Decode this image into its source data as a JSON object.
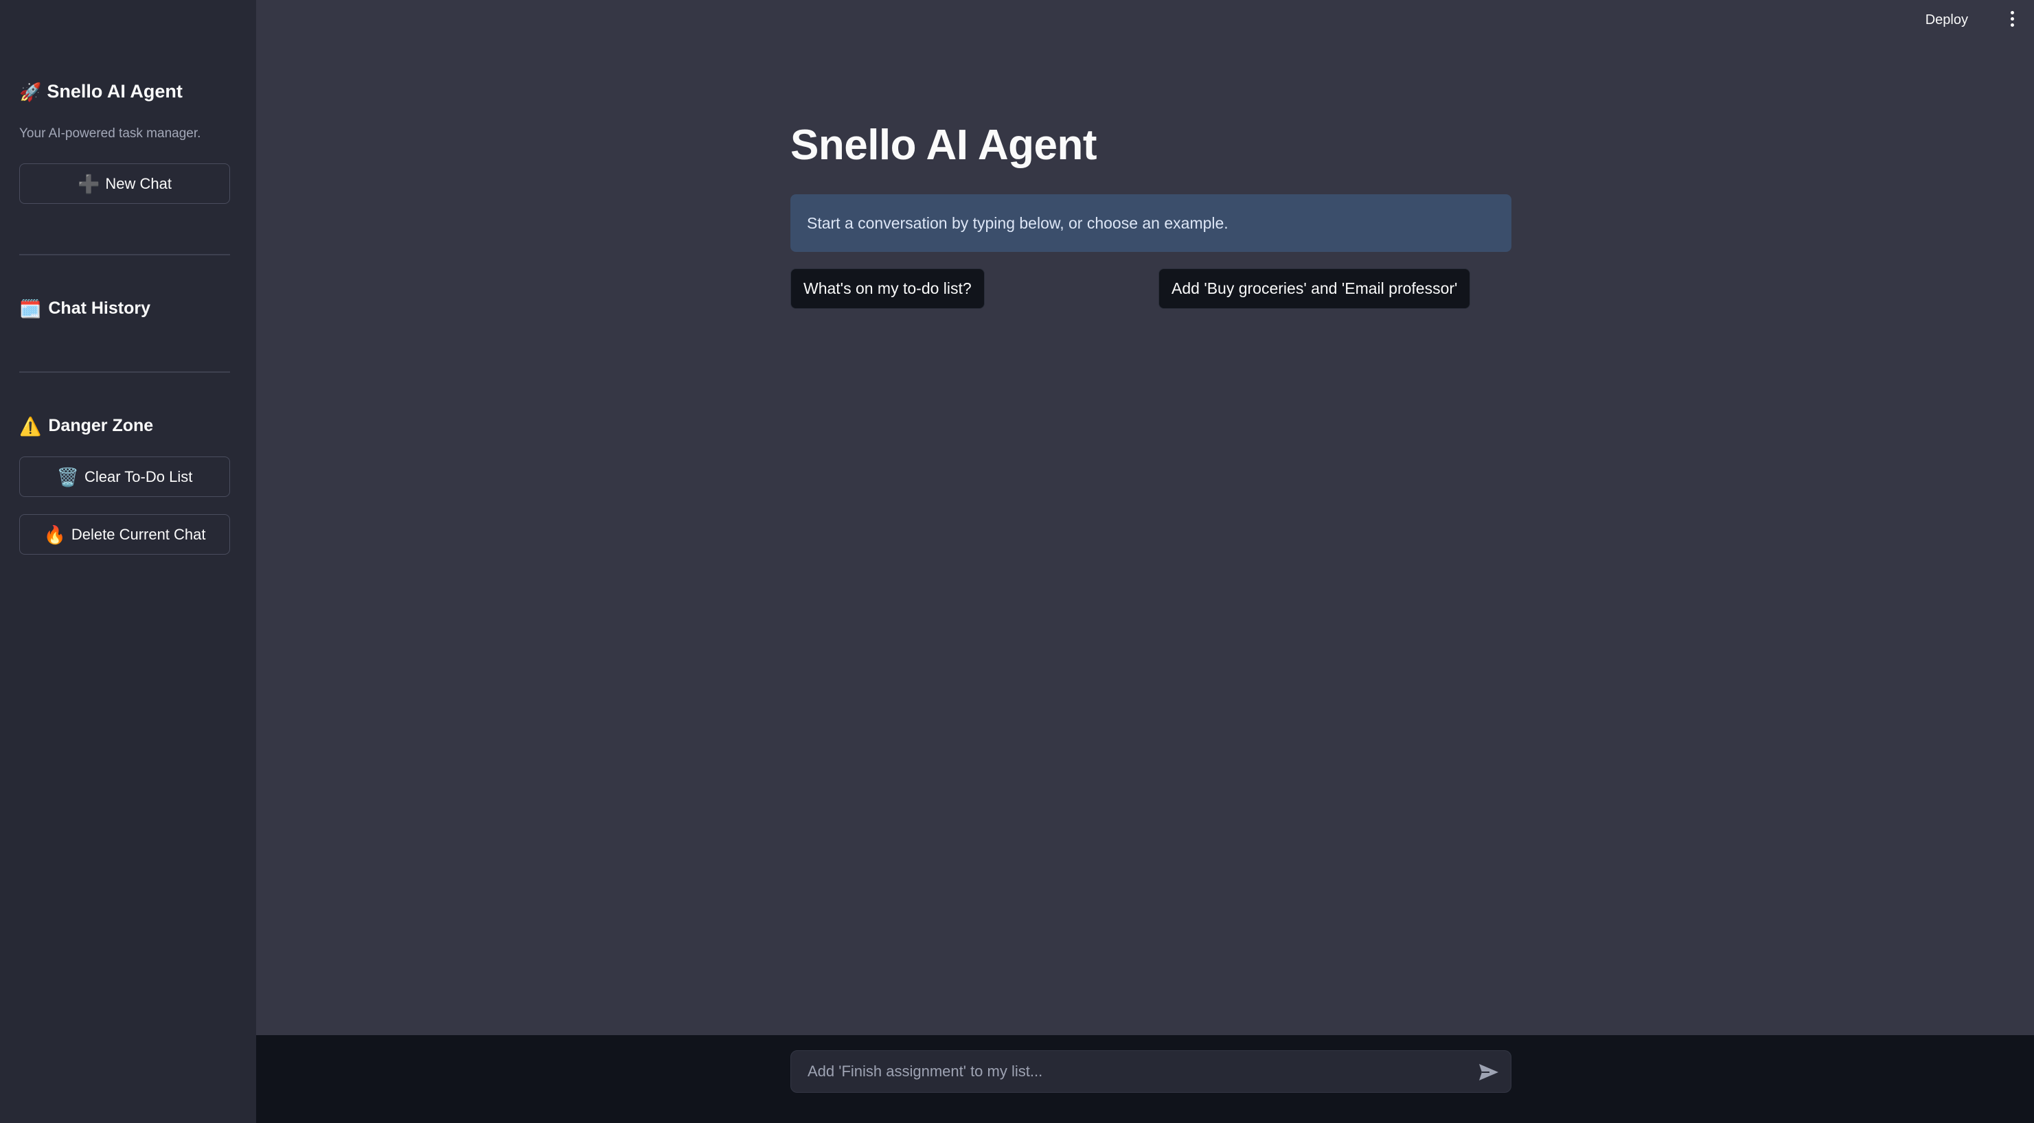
{
  "topbar": {
    "deploy_label": "Deploy",
    "menu_icon": "vertical-ellipsis-icon"
  },
  "sidebar": {
    "title_icon": "🚀",
    "title": "Snello AI Agent",
    "subtitle": "Your AI-powered task manager.",
    "new_chat": {
      "icon": "➕",
      "label": "New Chat"
    },
    "history_icon": "🗓️",
    "history_heading": "Chat History",
    "danger_icon": "⚠️",
    "danger_heading": "Danger Zone",
    "clear_todo": {
      "icon": "🗑️",
      "label": "Clear To-Do List"
    },
    "delete_chat": {
      "icon": "🔥",
      "label": "Delete Current Chat"
    }
  },
  "main": {
    "title": "Snello AI Agent",
    "info_text": "Start a conversation by typing below, or choose an example.",
    "examples": [
      "What's on my to-do list?",
      "Add 'Buy groceries' and 'Email professor'"
    ]
  },
  "chat_input": {
    "placeholder": "Add 'Finish assignment' to my list...",
    "value": "",
    "send_icon": "send-icon"
  }
}
